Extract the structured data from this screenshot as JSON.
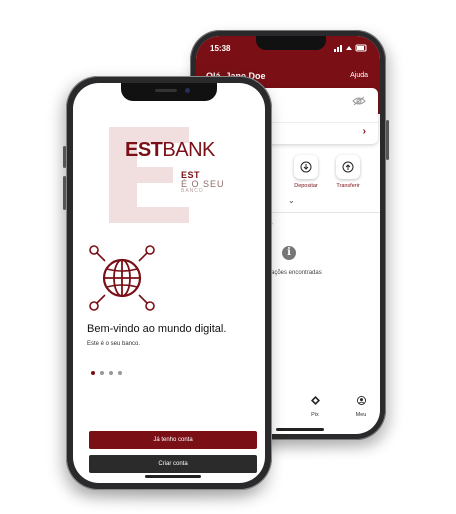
{
  "colors": {
    "brand": "#7a1016",
    "dark": "#2b2b2b",
    "accent_light": "#f1dfe0"
  },
  "back_phone": {
    "status_time": "15:38",
    "greeting": "Olá, Jane Doe",
    "help_label": "Ajuda",
    "actions": [
      {
        "label": "Depositar",
        "icon": "download-icon"
      },
      {
        "label": "Transferir",
        "icon": "upload-icon"
      }
    ],
    "section_fragment": "S",
    "empty_text": "sações encontradas",
    "tabs": [
      {
        "label": "Pix",
        "icon": "pix-icon"
      },
      {
        "label": "Meu",
        "icon": "user-icon"
      }
    ]
  },
  "front_phone": {
    "logo_est": "EST",
    "logo_bank": "BANK",
    "tagline_1": "EST",
    "tagline_2": "É O SEU",
    "tagline_3": "BANCO",
    "welcome_title": "Bem-vindo ao mundo digital.",
    "welcome_subtitle": "Este é o seu banco.",
    "primary_button": "Já tenho conta",
    "secondary_button": "Criar conta"
  }
}
